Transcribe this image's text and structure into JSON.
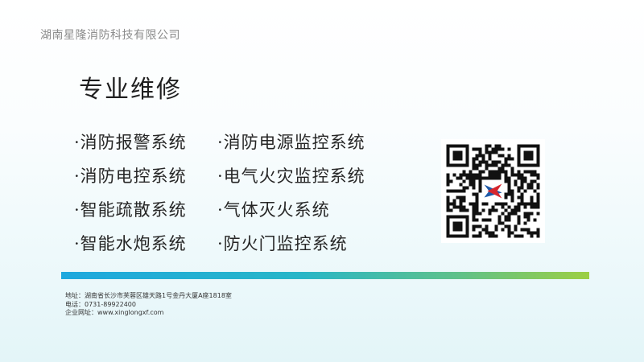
{
  "company_name": "湖南星隆消防科技有限公司",
  "title": "专业维修",
  "systems": [
    "·消防报警系统",
    "·消防电源监控系统",
    "·消防电控系统",
    "·电气火灾监控系统",
    "·智能疏散系统",
    "·气体灭火系统",
    "·智能水炮系统",
    "·防火门监控系统"
  ],
  "contact": {
    "address": "地址：湖南省长沙市芙蓉区雄天路1号金丹大厦A座1818室",
    "phone": "电话：0731-89922400",
    "website": "企业网址：www.xinglongxf.com"
  },
  "colors": {
    "bar_start": "#1ea8de",
    "bar_end": "#9ccf43",
    "logo_blue": "#1e5aa8",
    "logo_red": "#d6262e"
  },
  "qr_code": {
    "icon": "qr-code-icon"
  }
}
